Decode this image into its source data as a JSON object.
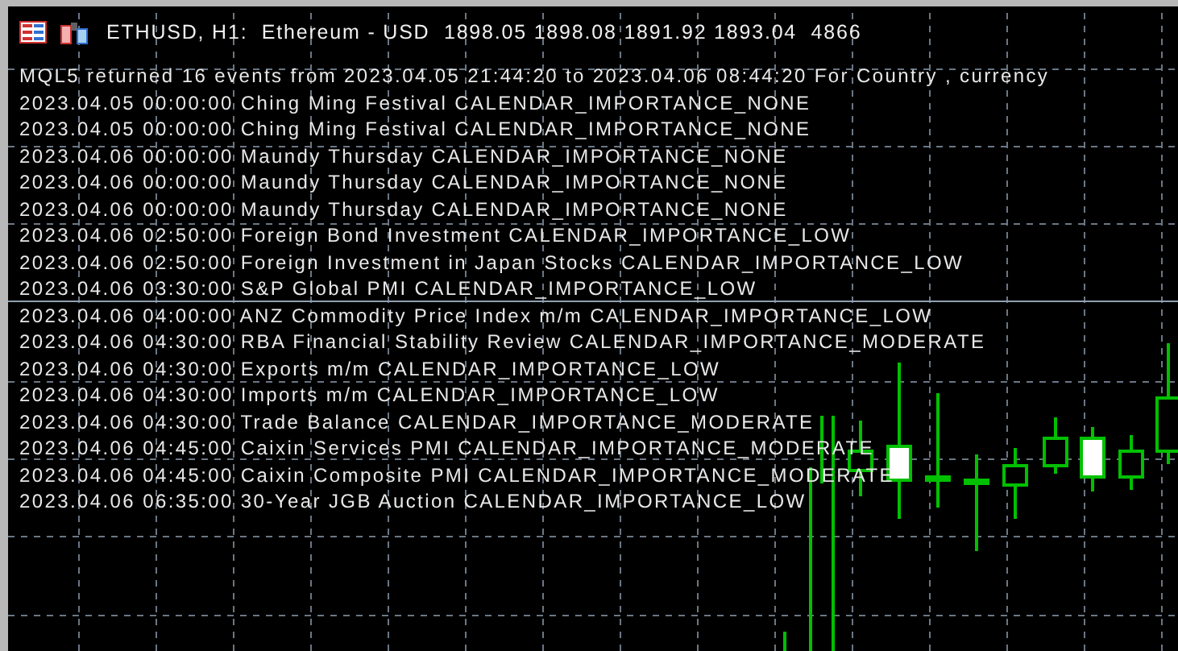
{
  "header": {
    "title": "ETHUSD, H1:  Ethereum - USD  1898.05 1898.08 1891.92 1893.04  4866"
  },
  "log_lines": [
    "MQL5 returned 16 events from 2023.04.05 21:44:20 to 2023.04.06 08:44:20 For Country , currency",
    "2023.04.05 00:00:00 Ching Ming Festival CALENDAR_IMPORTANCE_NONE",
    "2023.04.05 00:00:00 Ching Ming Festival CALENDAR_IMPORTANCE_NONE",
    "2023.04.06 00:00:00 Maundy Thursday CALENDAR_IMPORTANCE_NONE",
    "2023.04.06 00:00:00 Maundy Thursday CALENDAR_IMPORTANCE_NONE",
    "2023.04.06 00:00:00 Maundy Thursday CALENDAR_IMPORTANCE_NONE",
    "2023.04.06 02:50:00 Foreign Bond Investment CALENDAR_IMPORTANCE_LOW",
    "2023.04.06 02:50:00 Foreign Investment in Japan Stocks CALENDAR_IMPORTANCE_LOW",
    "2023.04.06 03:30:00 S&P Global PMI CALENDAR_IMPORTANCE_LOW",
    "2023.04.06 04:00:00 ANZ Commodity Price Index m/m CALENDAR_IMPORTANCE_LOW",
    "2023.04.06 04:30:00 RBA Financial Stability Review CALENDAR_IMPORTANCE_MODERATE",
    "2023.04.06 04:30:00 Exports m/m CALENDAR_IMPORTANCE_LOW",
    "2023.04.06 04:30:00 Imports m/m CALENDAR_IMPORTANCE_LOW",
    "2023.04.06 04:30:00 Trade Balance CALENDAR_IMPORTANCE_MODERATE",
    "2023.04.06 04:45:00 Caixin Services PMI CALENDAR_IMPORTANCE_MODERATE",
    "2023.04.06 04:45:00 Caixin Composite PMI CALENDAR_IMPORTANCE_MODERATE",
    "2023.04.06 06:35:00 30-Year JGB Auction CALENDAR_IMPORTANCE_LOW"
  ]
}
